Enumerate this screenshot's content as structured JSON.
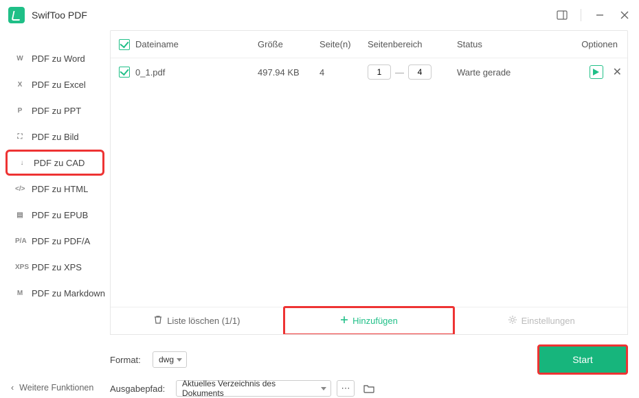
{
  "app": {
    "title": "SwifToo PDF"
  },
  "sidebar": {
    "items": [
      {
        "icon": "W",
        "label": "PDF zu Word"
      },
      {
        "icon": "X",
        "label": "PDF zu Excel"
      },
      {
        "icon": "P",
        "label": "PDF zu PPT"
      },
      {
        "icon": "⛶",
        "label": "PDF zu Bild"
      },
      {
        "icon": "↓",
        "label": "PDF zu CAD",
        "selected": true
      },
      {
        "icon": "</>",
        "label": "PDF zu HTML"
      },
      {
        "icon": "▤",
        "label": "PDF zu EPUB"
      },
      {
        "icon": "P/A",
        "label": "PDF zu PDF/A"
      },
      {
        "icon": "XPS",
        "label": "PDF zu XPS"
      },
      {
        "icon": "M",
        "label": "PDF zu Markdown"
      }
    ],
    "more": "Weitere Funktionen"
  },
  "table": {
    "headers": {
      "filename": "Dateiname",
      "size": "Größe",
      "pages": "Seite(n)",
      "range": "Seitenbereich",
      "status": "Status",
      "options": "Optionen"
    },
    "rows": [
      {
        "filename": "0_1.pdf",
        "size": "497.94 KB",
        "pages": "4",
        "range_from": "1",
        "range_to": "4",
        "status": "Warte gerade"
      }
    ],
    "actions": {
      "clear": "Liste löschen (1/1)",
      "add": "Hinzufügen",
      "settings": "Einstellungen"
    }
  },
  "bottom": {
    "format_label": "Format:",
    "format_value": "dwg",
    "outpath_label": "Ausgabepfad:",
    "outpath_value": "Aktuelles Verzeichnis des Dokuments",
    "start": "Start"
  }
}
